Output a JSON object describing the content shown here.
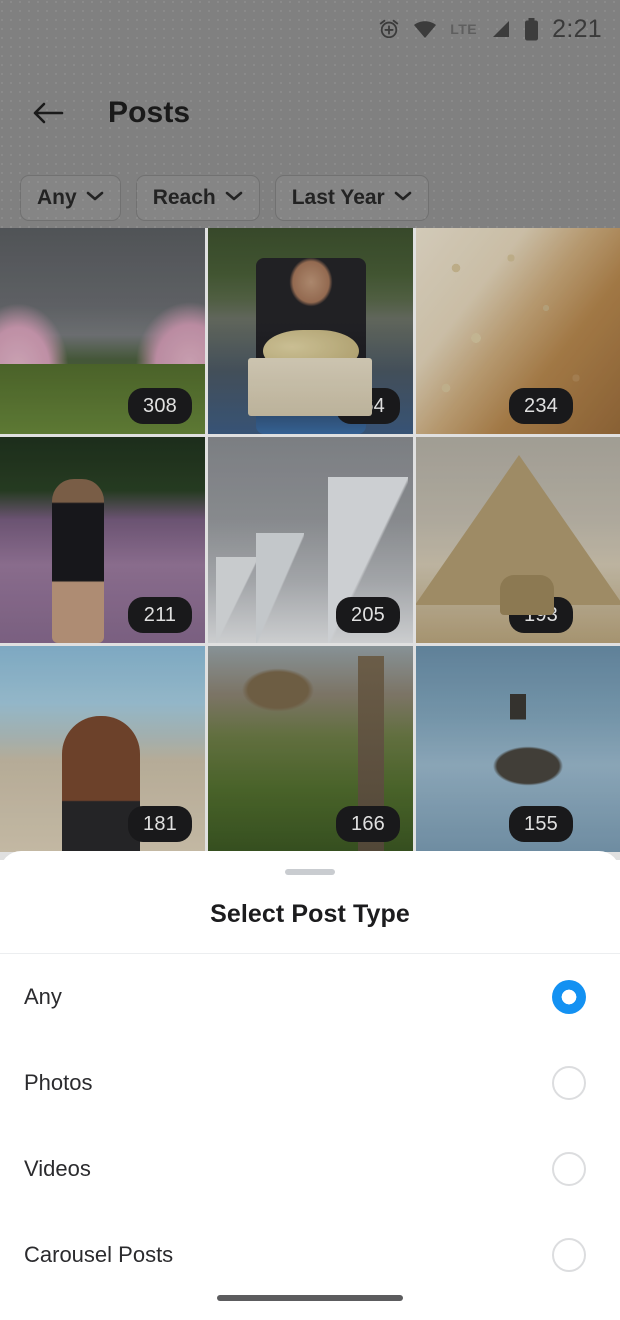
{
  "statusbar": {
    "time": "2:21",
    "icons": [
      "add-alarm-icon",
      "wifi-icon",
      "lte-icon",
      "cellular-signal-icon",
      "battery-icon"
    ],
    "lte_label": "LTE"
  },
  "header": {
    "title": "Posts",
    "back_icon": "back-arrow-icon"
  },
  "filters": [
    {
      "label": "Any",
      "icon": "chevron-down-icon"
    },
    {
      "label": "Reach",
      "icon": "chevron-down-icon"
    },
    {
      "label": "Last Year",
      "icon": "chevron-down-icon"
    }
  ],
  "grid": {
    "rows": [
      [
        {
          "count": "308",
          "art": "t-blossom",
          "alt": "cherry blossom park"
        },
        {
          "count": "264",
          "art": "t-pumpkin",
          "alt": "woman holding pumpkin crate"
        },
        {
          "count": "234",
          "art": "t-bread",
          "alt": "focaccia bread"
        }
      ],
      [
        {
          "count": "211",
          "art": "t-heather",
          "alt": "woman in heather field"
        },
        {
          "count": "205",
          "art": "t-snow",
          "alt": "snow covered pine trees"
        },
        {
          "count": "193",
          "art": "t-pyramid",
          "alt": "pyramid and sphinx"
        }
      ],
      [
        {
          "count": "181",
          "art": "t-beach",
          "alt": "woman facing the sea"
        },
        {
          "count": "166",
          "art": "t-park",
          "alt": "park with snowdrops"
        },
        {
          "count": "155",
          "art": "t-goose",
          "alt": "goose swimming"
        }
      ]
    ]
  },
  "sheet": {
    "title": "Select Post Type",
    "handle": "drag-handle",
    "options": [
      {
        "label": "Any",
        "selected": true
      },
      {
        "label": "Photos",
        "selected": false
      },
      {
        "label": "Videos",
        "selected": false
      },
      {
        "label": "Carousel Posts",
        "selected": false
      }
    ]
  },
  "navbar": {
    "pill": "home-gesture-pill"
  },
  "colors": {
    "accent": "#1391f2",
    "scrim": "#808080",
    "badge_bg": "#1d1d1f",
    "radio_unselected": "#dcdddf",
    "sheet_bg": "#ffffff"
  }
}
